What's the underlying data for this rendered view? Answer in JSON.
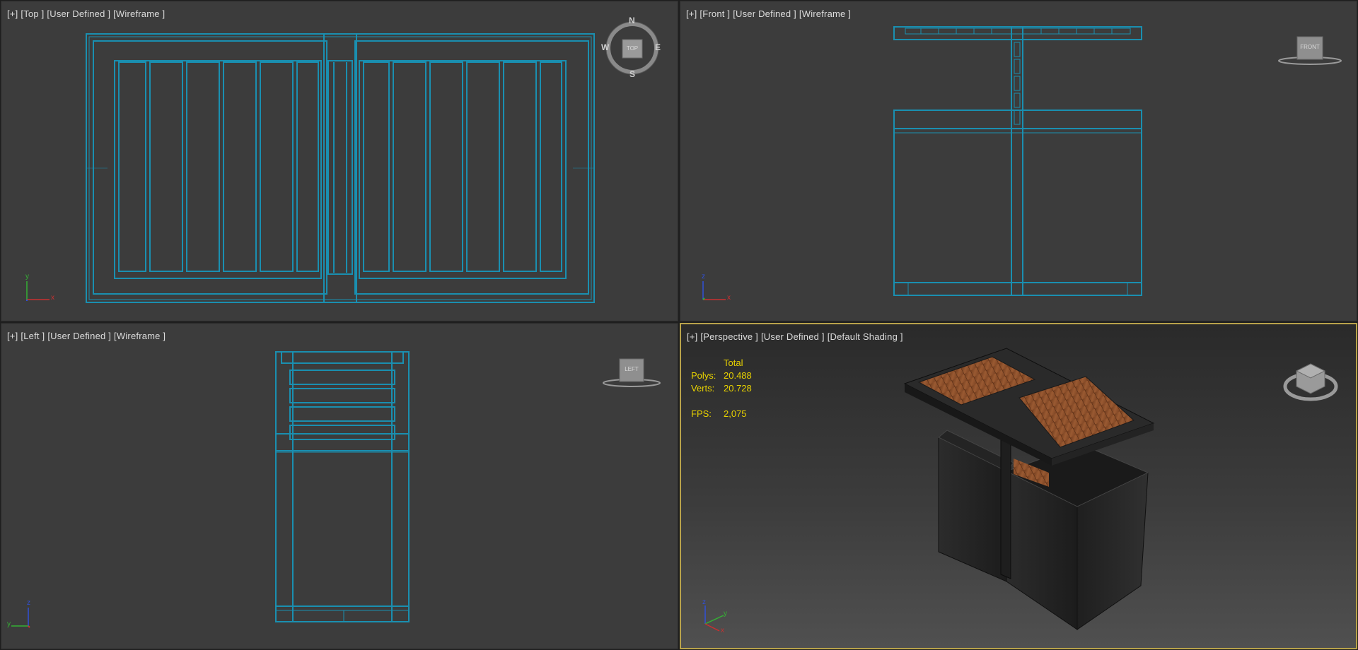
{
  "viewports": {
    "top": {
      "label_parts": [
        "[+]",
        "[Top ]",
        "[User Defined ]",
        "[Wireframe ]"
      ],
      "compass": {
        "n": "N",
        "s": "S",
        "e": "E",
        "w": "W",
        "cube": "TOP"
      },
      "axes": {
        "up": "y",
        "right": "x"
      }
    },
    "front": {
      "label_parts": [
        "[+]",
        "[Front ]",
        "[User Defined ]",
        "[Wireframe ]"
      ],
      "cube": "FRONT",
      "axes": {
        "up": "z",
        "right": "x"
      }
    },
    "left": {
      "label_parts": [
        "[+]",
        "[Left ]",
        "[User Defined ]",
        "[Wireframe ]"
      ],
      "cube": "LEFT",
      "axes": {
        "up": "z",
        "right": "y"
      }
    },
    "perspective": {
      "label_parts": [
        "[+]",
        "[Perspective ]",
        "[User Defined ]",
        "[Default Shading ]"
      ],
      "stats": {
        "header": "Total",
        "polys_label": "Polys:",
        "polys_value": "20.488",
        "verts_label": "Verts:",
        "verts_value": "20.728",
        "fps_label": "FPS:",
        "fps_value": "2,075"
      },
      "axes": {
        "up": "z",
        "right": "y",
        "left": "x"
      }
    }
  },
  "colors": {
    "wire": "#1a8fb0",
    "viewport_bg": "#3c3c3c",
    "active_border": "#b8a24a",
    "stats_text": "#e8d200",
    "wood": "#8a4e2a",
    "bin_dark": "#2a2a2a"
  },
  "icons": [
    "viewcube-icon",
    "compass-icon",
    "axis-tripod-icon"
  ]
}
